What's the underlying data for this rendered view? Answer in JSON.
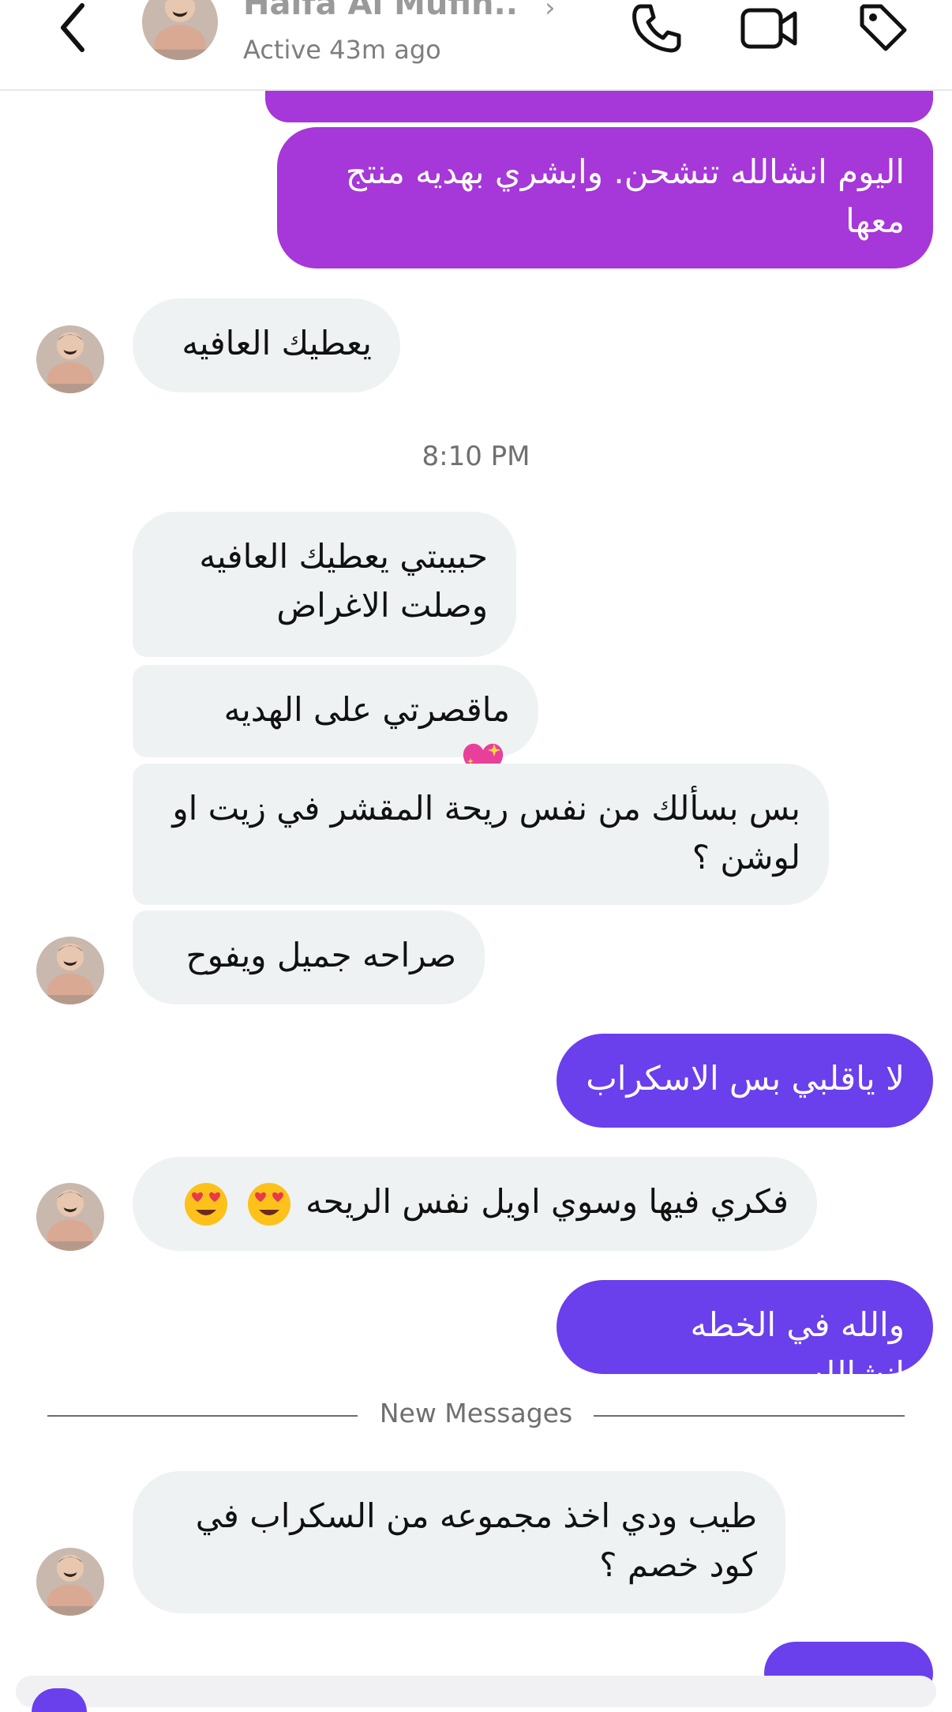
{
  "header": {
    "contact_name": "Haifa Al Mufin..",
    "presence": "Active 43m ago",
    "icons": [
      "back-chevron",
      "avatar",
      "phone",
      "video-camera",
      "tag"
    ]
  },
  "colors": {
    "incoming_bubble": "#eff2f3",
    "outgoing_magenta": "#a637d8",
    "outgoing_violet": "#6a3fec"
  },
  "messages": [
    {
      "id": "m1",
      "direction": "out",
      "text": "اليوم انشالله تنشحن. وابشري بهديه منتج معها"
    },
    {
      "id": "m2",
      "direction": "in",
      "text": "يعطيك العافيه"
    },
    {
      "id": "m3",
      "direction": "in",
      "text": "حبيبتي يعطيك العافيه وصلت الاغراض"
    },
    {
      "id": "m4",
      "direction": "in",
      "text": "ماقصرتي على الهديه"
    },
    {
      "id": "m5",
      "direction": "in",
      "text": "بس بسألك من نفس ريحة  المقشر  في زيت او لوشن ؟"
    },
    {
      "id": "m6",
      "direction": "in",
      "text": "صراحه جميل ويفوح"
    },
    {
      "id": "m7",
      "direction": "out",
      "text": "لا ياقلبي بس الاسكراب"
    },
    {
      "id": "m8",
      "direction": "in",
      "text": "فكري فيها وسوي اويل نفس الريحه"
    },
    {
      "id": "m9",
      "direction": "out",
      "text": "والله في الخطه انشالله"
    },
    {
      "id": "m10",
      "direction": "in",
      "text": "طيب ودي اخذ مجموعه من السكراب في كود خصم ؟"
    }
  ],
  "time_separator": "8:10 PM",
  "new_messages_label": "New Messages"
}
